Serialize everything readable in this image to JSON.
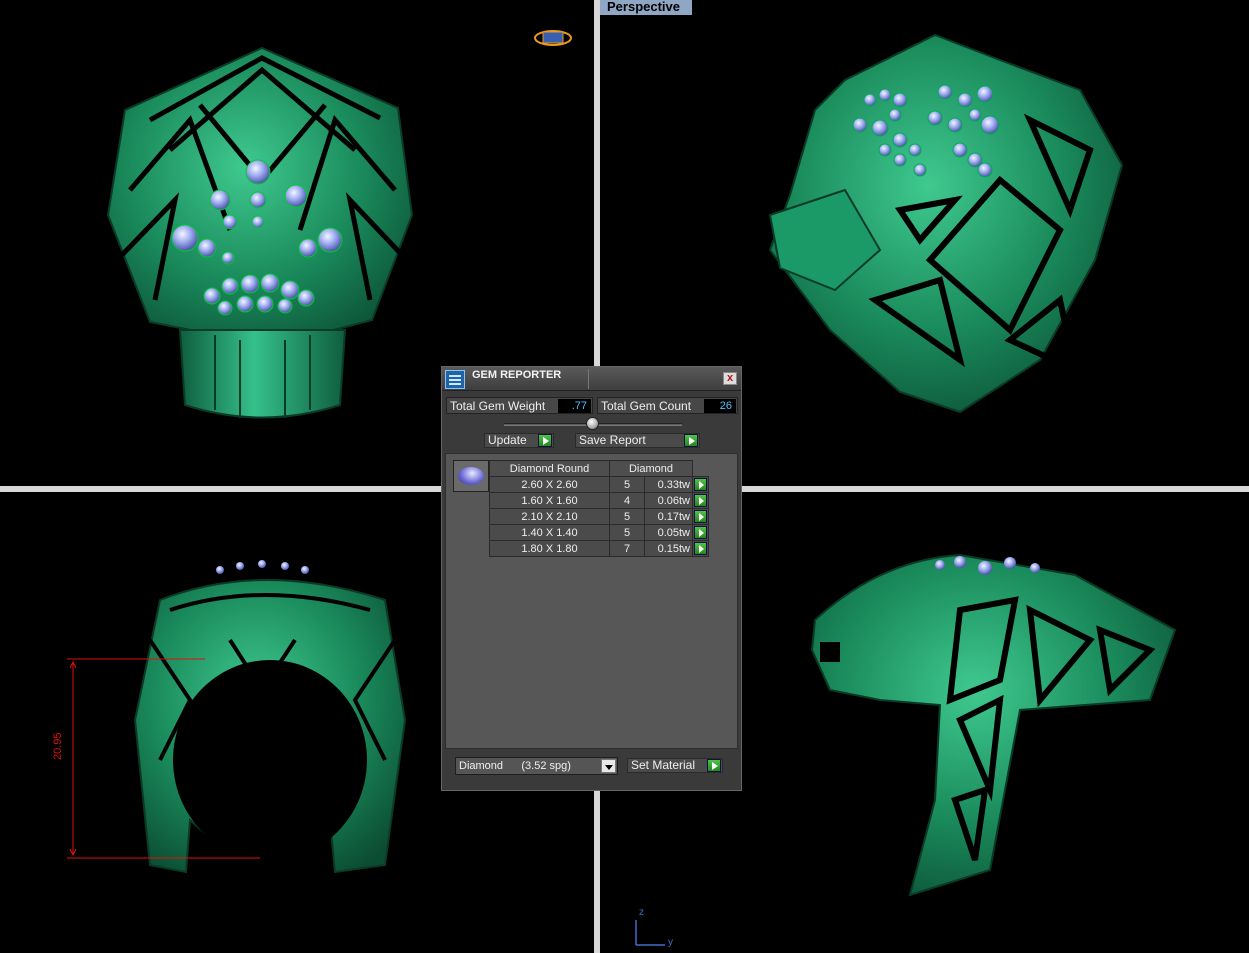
{
  "viewport": {
    "label": "Perspective"
  },
  "dimension": {
    "value": "20.95"
  },
  "axis": {
    "z": "z",
    "y": "y"
  },
  "gem_reporter": {
    "title": "GEM REPORTER",
    "close_symbol": "x",
    "total_gem_weight_label": "Total Gem Weight",
    "total_gem_weight_value": ".77",
    "total_gem_count_label": "Total Gem Count",
    "total_gem_count_value": "26",
    "update_label": "Update",
    "save_report_label": "Save Report",
    "table": {
      "headers": [
        "Diamond Round",
        "Diamond"
      ],
      "rows": [
        {
          "size": "2.60 X 2.60",
          "count": "5",
          "weight": "0.33tw"
        },
        {
          "size": "1.60 X 1.60",
          "count": "4",
          "weight": "0.06tw"
        },
        {
          "size": "2.10 X 2.10",
          "count": "5",
          "weight": "0.17tw"
        },
        {
          "size": "1.40 X 1.40",
          "count": "5",
          "weight": "0.05tw"
        },
        {
          "size": "1.80 X 1.80",
          "count": "7",
          "weight": "0.15tw"
        }
      ]
    },
    "material_select_value": "Diamond      (3.52 spg)",
    "set_material_label": "Set Material"
  },
  "colors": {
    "model_green": "#1e8c5f",
    "model_highlight": "#5fe0a8",
    "gem_blue": "#8f9ee8",
    "viewport_label_bg": "#8fa6c4",
    "dimension_red": "#e01010"
  },
  "icons": [
    "gem-reporter-logo-icon",
    "close-icon",
    "update-arrow-icon",
    "save-report-arrow-icon",
    "diamond-round-icon",
    "row-arrow-icon",
    "dropdown-arrow-icon",
    "set-material-arrow-icon",
    "view-cube-icon"
  ]
}
